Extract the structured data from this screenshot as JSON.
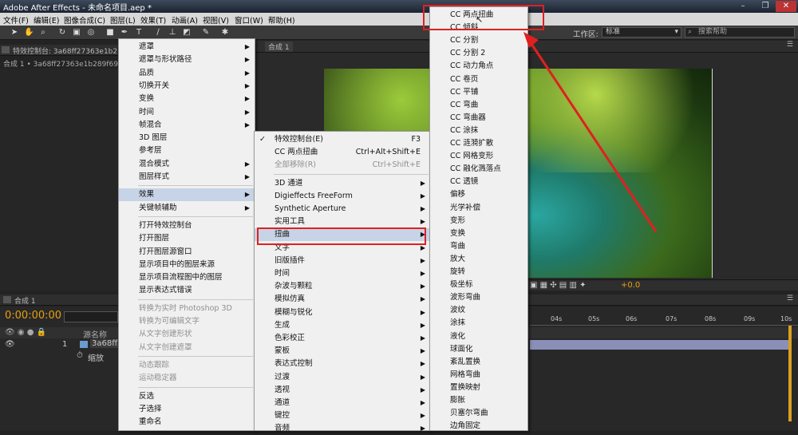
{
  "app": {
    "title": "Adobe After Effects - 未命名项目.aep *"
  },
  "window_buttons": [
    "–",
    "❐",
    "✕"
  ],
  "menubar": [
    "文件(F)",
    "编辑(E)",
    "图像合成(C)",
    "图层(L)",
    "效果(T)",
    "动画(A)",
    "视图(V)",
    "窗口(W)",
    "帮助(H)"
  ],
  "toolbar": {
    "workspace_label": "工作区:",
    "workspace_value": "标准",
    "search_placeholder": "搜索帮助"
  },
  "project_panel": {
    "tab": "特效控制台: 3a68ff27363e1b289f69628c7b",
    "sub": "合成 1 • 3a68ff27363e1b289f69628c7b"
  },
  "comp_panel": {
    "tab": "合成 1",
    "zoom_value": "+0.0"
  },
  "timeline": {
    "tab": "合成 1",
    "timecode": "0:00:00:00",
    "column_label": "源名称",
    "layer_number": "1",
    "layer_name": "3a68ff2",
    "property": "缩放",
    "ruler_ticks": [
      "04s",
      "05s",
      "06s",
      "07s",
      "08s",
      "09s",
      "10s"
    ]
  },
  "context_menu": {
    "items": [
      {
        "label": "遮罩",
        "sub": true
      },
      {
        "label": "遮罩与形状路径",
        "sub": true
      },
      {
        "label": "品质",
        "sub": true
      },
      {
        "label": "切换开关",
        "sub": true
      },
      {
        "label": "变换",
        "sub": true
      },
      {
        "label": "时间",
        "sub": true
      },
      {
        "label": "帧混合",
        "sub": true
      },
      {
        "label": "3D 图层",
        "sub": false
      },
      {
        "label": "参考层",
        "sub": false
      },
      {
        "label": "混合模式",
        "sub": true
      },
      {
        "label": "图层样式",
        "sub": true
      },
      {
        "label": "效果",
        "sub": true,
        "hl": true
      },
      {
        "label": "关键帧辅助",
        "sub": true
      },
      {
        "label": "打开特效控制台",
        "sub": false
      },
      {
        "label": "打开图层",
        "sub": false
      },
      {
        "label": "打开图层源窗口",
        "sub": false
      },
      {
        "label": "显示项目中的图层来源",
        "sub": false
      },
      {
        "label": "显示项目流程图中的图层",
        "sub": false
      },
      {
        "label": "显示表达式错误",
        "sub": false
      },
      {
        "label": "转换为实时 Photoshop 3D",
        "dis": true
      },
      {
        "label": "转换为可编辑文字",
        "dis": true
      },
      {
        "label": "从文字创建形状",
        "dis": true
      },
      {
        "label": "从文字创建遮罩",
        "dis": true
      },
      {
        "label": "动态跟踪",
        "dis": true
      },
      {
        "label": "运动稳定器",
        "dis": true
      },
      {
        "label": "反选",
        "sub": false
      },
      {
        "label": "子选择",
        "sub": false
      },
      {
        "label": "重命名",
        "sub": false
      }
    ]
  },
  "effects_menu": {
    "items": [
      {
        "label": "特效控制台(E)",
        "shortcut": "F3",
        "check": true
      },
      {
        "label": "CC 两点扭曲",
        "shortcut": "Ctrl+Alt+Shift+E"
      },
      {
        "label": "全部移除(R)",
        "shortcut": "Ctrl+Shift+E",
        "dis": true
      },
      {
        "label": "3D 通道",
        "sub": true
      },
      {
        "label": "Digieffects FreeForm",
        "sub": true
      },
      {
        "label": "Synthetic Aperture",
        "sub": true
      },
      {
        "label": "实用工具",
        "sub": true
      },
      {
        "label": "扭曲",
        "sub": true,
        "hl": true
      },
      {
        "label": "文字",
        "sub": true
      },
      {
        "label": "旧版插件",
        "sub": true
      },
      {
        "label": "时间",
        "sub": true
      },
      {
        "label": "杂波与颗粒",
        "sub": true
      },
      {
        "label": "模拟仿真",
        "sub": true
      },
      {
        "label": "模糊与锐化",
        "sub": true
      },
      {
        "label": "生成",
        "sub": true
      },
      {
        "label": "色彩校正",
        "sub": true
      },
      {
        "label": "蒙板",
        "sub": true
      },
      {
        "label": "表达式控制",
        "sub": true
      },
      {
        "label": "过渡",
        "sub": true
      },
      {
        "label": "透视",
        "sub": true
      },
      {
        "label": "通道",
        "sub": true
      },
      {
        "label": "键控",
        "sub": true
      },
      {
        "label": "音频",
        "sub": true
      }
    ]
  },
  "distort_menu": {
    "items": [
      "CC 两点扭曲",
      "CC 倾斜",
      "CC 分割",
      "CC 分割 2",
      "CC 动力角点",
      "CC 卷页",
      "CC 平铺",
      "CC 弯曲",
      "CC 弯曲器",
      "CC 涂抹",
      "CC 涟漪扩散",
      "CC 网格变形",
      "CC 融化溅落点",
      "CC 透镜",
      "偏移",
      "光学补偿",
      "变形",
      "变换",
      "弯曲",
      "放大",
      "旋转",
      "极坐标",
      "波形弯曲",
      "波纹",
      "涂抹",
      "液化",
      "球面化",
      "紊乱置换",
      "网格弯曲",
      "置换映射",
      "膨胀",
      "贝塞尔弯曲",
      "边角固定"
    ]
  },
  "colors": {
    "highlight": "#c7d3e6",
    "callout": "#e02020",
    "timecode": "#e8a010"
  }
}
